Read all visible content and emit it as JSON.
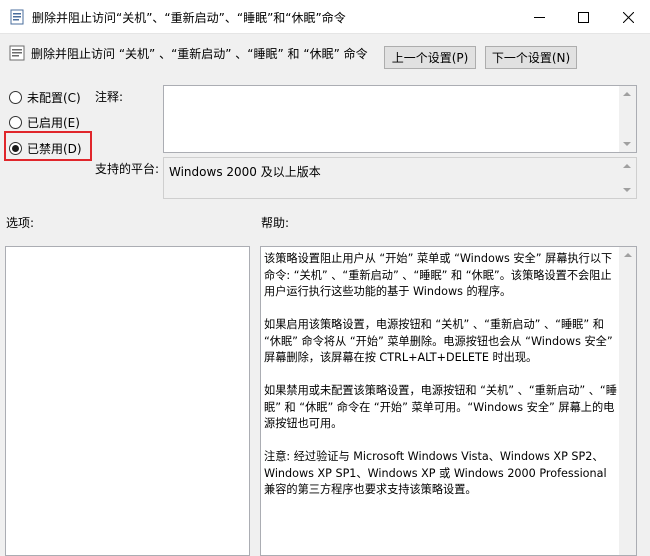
{
  "window": {
    "title": "删除并阻止访问“关机”、“重新启动”、“睡眠”和“休眠”命令",
    "minimize_icon": "minimize-icon",
    "maximize_icon": "maximize-icon",
    "close_icon": "close-icon"
  },
  "header": {
    "setting_title": "删除并阻止访问 “关机” 、“重新启动” 、“睡眠” 和 “休眠” 命令",
    "prev_button": "上一个设置(P)",
    "next_button": "下一个设置(N)"
  },
  "state": {
    "options": [
      {
        "label": "未配置(C)",
        "checked": false
      },
      {
        "label": "已启用(E)",
        "checked": false
      },
      {
        "label": "已禁用(D)",
        "checked": true
      }
    ],
    "highlight_color": "#e0262b"
  },
  "comment": {
    "label": "注释:",
    "value": ""
  },
  "platform": {
    "label": "支持的平台:",
    "value": "Windows 2000 及以上版本"
  },
  "options_section": {
    "label": "选项:"
  },
  "help_section": {
    "label": "帮助:",
    "paragraphs": [
      "该策略设置阻止用户从 “开始” 菜单或 “Windows 安全” 屏幕执行以下命令: “关机” 、“重新启动” 、“睡眠” 和 “休眠”。该策略设置不会阻止用户运行执行这些功能的基于 Windows 的程序。",
      "如果启用该策略设置，电源按钮和 “关机” 、“重新启动” 、“睡眠” 和 “休眠” 命令将从 “开始” 菜单删除。电源按钮也会从 “Windows 安全” 屏幕删除，该屏幕在按 CTRL+ALT+DELETE 时出现。",
      "如果禁用或未配置该策略设置，电源按钮和 “关机” 、“重新启动” 、“睡眠” 和 “休眠” 命令在 “开始” 菜单可用。“Windows 安全” 屏幕上的电源按钮也可用。",
      "注意: 经过验证与 Microsoft Windows Vista、Windows XP SP2、Windows XP SP1、Windows XP 或 Windows 2000 Professional 兼容的第三方程序也要求支持该策略设置。"
    ]
  }
}
